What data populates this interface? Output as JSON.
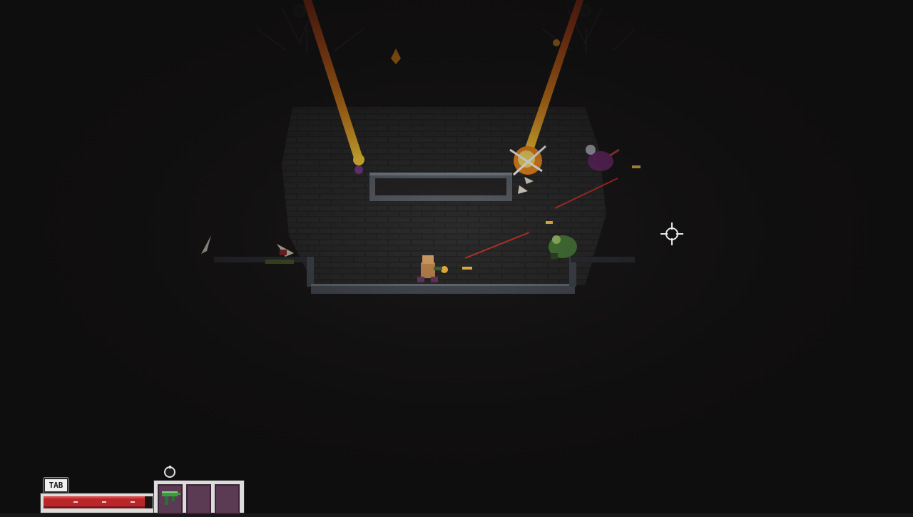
{
  "hud": {
    "tab_key_label": "TAB",
    "health_fraction": 0.93,
    "inventory_slots": [
      {
        "item": "green-smg-icon",
        "filled": true
      },
      {
        "item": "",
        "filled": false
      },
      {
        "item": "",
        "filled": false
      }
    ],
    "bomb_icon": "bomb-icon",
    "crosshair_icon": "crosshair-icon"
  },
  "colors": {
    "background": "#1a1818",
    "brick": "#2c2b2b",
    "stone": "#6a7078",
    "fire": "#f0a020",
    "laser": "#c0332b",
    "health": "#b8282b",
    "slot": "#5b3a53"
  }
}
